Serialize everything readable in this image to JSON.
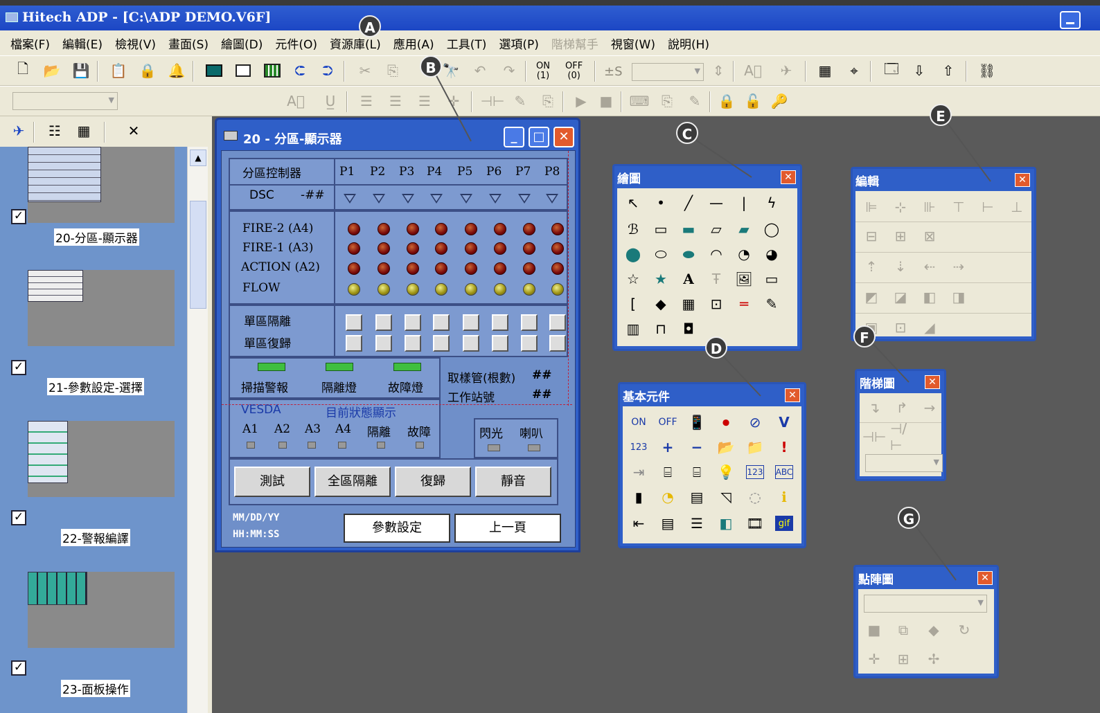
{
  "app": {
    "title": "Hitech ADP - [C:\\ADP  DEMO.V6F]"
  },
  "menu": [
    {
      "label": "檔案(F)",
      "enabled": true
    },
    {
      "label": "編輯(E)",
      "enabled": true
    },
    {
      "label": "檢視(V)",
      "enabled": true
    },
    {
      "label": "畫面(S)",
      "enabled": true
    },
    {
      "label": "繪圖(D)",
      "enabled": true
    },
    {
      "label": "元件(O)",
      "enabled": true
    },
    {
      "label": "資源庫(L)",
      "enabled": true
    },
    {
      "label": "應用(A)",
      "enabled": true
    },
    {
      "label": "工具(T)",
      "enabled": true
    },
    {
      "label": "選項(P)",
      "enabled": true
    },
    {
      "label": "階梯幫手",
      "enabled": false
    },
    {
      "label": "視窗(W)",
      "enabled": true
    },
    {
      "label": "說明(H)",
      "enabled": true
    }
  ],
  "toolbar": {
    "on_label": "ON",
    "on_sub": "(1)",
    "off_label": "OFF",
    "off_sub": "(0)",
    "pm_label": "±S"
  },
  "markers": {
    "a": "A",
    "b": "B",
    "c": "C",
    "d": "D",
    "e": "E",
    "f": "F",
    "g": "G"
  },
  "screens": [
    {
      "label": "20-分區-顯示器",
      "checked": true
    },
    {
      "label": "21-參數設定-選擇",
      "checked": true
    },
    {
      "label": "22-警報編譯",
      "checked": true
    },
    {
      "label": "23-面板操作",
      "checked": true
    }
  ],
  "window": {
    "title": "20 - 分區-顯示器"
  },
  "hmi": {
    "header_title": "分區控制器",
    "dsc": "DSC",
    "dsc_value": "-##",
    "ports": [
      "P1",
      "P2",
      "P3",
      "P4",
      "P5",
      "P6",
      "P7",
      "P8"
    ],
    "signals": [
      "FIRE-2  (A4)",
      "FIRE-1  (A3)",
      "ACTION (A2)",
      "FLOW"
    ],
    "zone_isolate": "單區隔離",
    "zone_reset": "單區復歸",
    "scan_alarm": "掃描警報",
    "isolate_lamp": "隔離燈",
    "fault_lamp": "故障燈",
    "sample_pipe": "取樣管(根數)",
    "sample_pipe_value": "##",
    "station_no": "工作站號",
    "station_no_value": "##",
    "vesda": "VESDA",
    "status_display": "目前狀態顯示",
    "vesda_items": [
      "A1",
      "A2",
      "A3",
      "A4",
      "隔離",
      "故障"
    ],
    "flash": "閃光",
    "horn": "喇叭",
    "buttons": [
      "測試",
      "全區隔離",
      "復歸",
      "靜音"
    ],
    "date_format": "MM/DD/YY",
    "time_format": "HH:MM:SS",
    "param_button": "參數設定",
    "prev_button": "上一頁"
  },
  "palettes": {
    "draw": {
      "title": "繪圖",
      "text_icon": "A"
    },
    "basic": {
      "title": "基本元件",
      "on": "ON",
      "off": "OFF",
      "v": "V",
      "n123": "123",
      "abc": "ABC",
      "gif": "gif"
    },
    "edit": {
      "title": "編輯"
    },
    "ladder": {
      "title": "階梯圖"
    },
    "dot": {
      "title": "點陣圖"
    }
  }
}
